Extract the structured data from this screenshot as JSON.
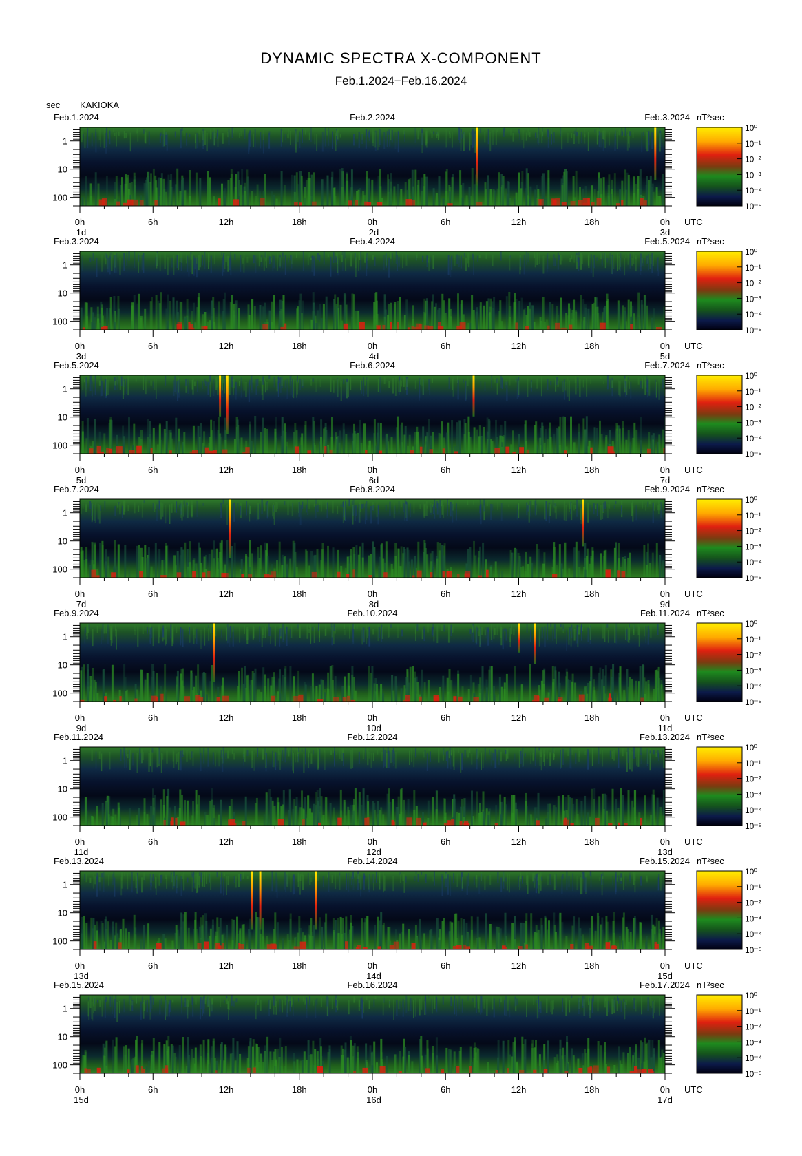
{
  "title": "DYNAMIC SPECTRA X-COMPONENT",
  "subtitle": "Feb.1.2024−Feb.16.2024",
  "period_label": "sec",
  "station": "KAKIOKA",
  "colorbar_unit": "nT²sec",
  "colorbar_ticks": [
    "10⁰",
    "10⁻¹",
    "10⁻²",
    "10⁻³",
    "10⁻⁴",
    "10⁻⁵"
  ],
  "y_ticks": [
    "1",
    "10",
    "100"
  ],
  "x_ticks": [
    "0h",
    "6h",
    "12h",
    "18h",
    "0h",
    "6h",
    "12h",
    "18h",
    "0h"
  ],
  "utc_label": "UTC",
  "colors": {
    "low": "#000010",
    "mid": "#1e7a1e",
    "high": "#e01010",
    "peak": "#ffe000"
  },
  "chart_data": {
    "type": "heatmap",
    "ylabel": "sec",
    "y_scale": "log",
    "color_scale": "log",
    "colorbar_range": [
      1e-05,
      1
    ],
    "panels": [
      {
        "date_left": "Feb.1.2024",
        "date_mid": "Feb.2.2024",
        "date_right": "Feb.3.2024",
        "day_left": "1d",
        "day_mid": "2d",
        "day_right": "3d",
        "spikes": [
          {
            "time_h": 32.6,
            "level": 1.0
          },
          {
            "time_h": 47.2,
            "level": 0.9
          }
        ]
      },
      {
        "date_left": "Feb.3.2024",
        "date_mid": "Feb.4.2024",
        "date_right": "Feb.5.2024",
        "day_left": "3d",
        "day_mid": "4d",
        "day_right": "5d",
        "spikes": []
      },
      {
        "date_left": "Feb.5.2024",
        "date_mid": "Feb.6.2024",
        "date_right": "Feb.7.2024",
        "day_left": "5d",
        "day_mid": "6d",
        "day_right": "7d",
        "spikes": [
          {
            "time_h": 11.5,
            "level": 0.7
          },
          {
            "time_h": 12.1,
            "level": 1.0
          },
          {
            "time_h": 32.3,
            "level": 0.7
          }
        ]
      },
      {
        "date_left": "Feb.7.2024",
        "date_mid": "Feb.8.2024",
        "date_right": "Feb.9.2024",
        "day_left": "7d",
        "day_mid": "8d",
        "day_right": "9d",
        "spikes": [
          {
            "time_h": 12.3,
            "level": 1.0
          },
          {
            "time_h": 41.3,
            "level": 0.8
          }
        ]
      },
      {
        "date_left": "Feb.9.2024",
        "date_mid": "Feb.10.2024",
        "date_right": "Feb.11.2024",
        "day_left": "9d",
        "day_mid": "10d",
        "day_right": "11d",
        "spikes": [
          {
            "time_h": 11.0,
            "level": 1.0
          },
          {
            "time_h": 36.0,
            "level": 0.5
          },
          {
            "time_h": 37.3,
            "level": 0.7
          }
        ]
      },
      {
        "date_left": "Feb.11.2024",
        "date_mid": "Feb.12.2024",
        "date_right": "Feb.13.2024",
        "day_left": "11d",
        "day_mid": "12d",
        "day_right": "13d",
        "spikes": []
      },
      {
        "date_left": "Feb.13.2024",
        "date_mid": "Feb.14.2024",
        "date_right": "Feb.15.2024",
        "day_left": "13d",
        "day_mid": "14d",
        "day_right": "15d",
        "spikes": [
          {
            "time_h": 14.1,
            "level": 1.0
          },
          {
            "time_h": 14.8,
            "level": 1.0
          },
          {
            "time_h": 19.4,
            "level": 1.0
          }
        ]
      },
      {
        "date_left": "Feb.15.2024",
        "date_mid": "Feb.16.2024",
        "date_right": "Feb.17.2024",
        "day_left": "15d",
        "day_mid": "16d",
        "day_right": "17d",
        "spikes": []
      }
    ]
  }
}
